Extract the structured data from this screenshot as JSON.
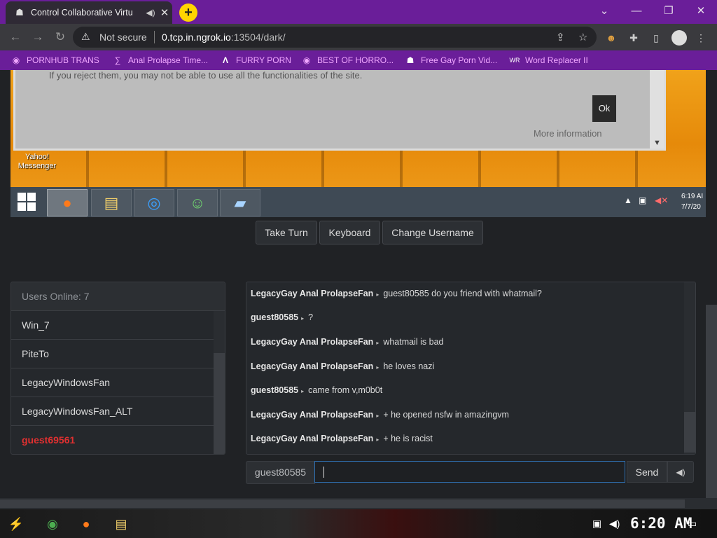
{
  "browser": {
    "tab_title": "Control Collaborative Virtu",
    "address_warning": "Not secure",
    "url_host": "0.tcp.in.ngrok.io",
    "url_rest": ":13504/dark/",
    "bookmarks": [
      {
        "label": "PORNHUB TRANS",
        "icon": "globe-icon"
      },
      {
        "label": "Anal Prolapse Time...",
        "icon": "bookmark-icon"
      },
      {
        "label": "FURRY PORN",
        "icon": "lambda-icon"
      },
      {
        "label": "BEST OF HORRO...",
        "icon": "globe-icon"
      },
      {
        "label": "Free Gay Porn Vid...",
        "icon": "site-icon"
      },
      {
        "label": "Word Replacer II",
        "icon": "extension-icon"
      }
    ]
  },
  "vm": {
    "dialog_text": "If you reject them, you may not be able to use all the functionalities of the site.",
    "ok_label": "Ok",
    "more_info": "More information",
    "desktop_icon": {
      "line1": "Yahoo!",
      "line2": "Messenger"
    },
    "clock_time": "6:19 AI",
    "clock_date": "7/7/20"
  },
  "controls": {
    "take_turn": "Take Turn",
    "keyboard": "Keyboard",
    "change_username": "Change Username"
  },
  "users": {
    "header": "Users Online: 7",
    "list": [
      "Win_7",
      "PiteTo",
      "LegacyWindowsFan",
      "LegacyWindowsFan_ALT",
      "guest69561"
    ]
  },
  "chat": {
    "messages": [
      {
        "user": "LegacyGay Anal ProlapseFan",
        "text": "guest80585 do you friend with whatmail?"
      },
      {
        "user": "guest80585",
        "text": "?"
      },
      {
        "user": "LegacyGay Anal ProlapseFan",
        "text": "whatmail is bad"
      },
      {
        "user": "LegacyGay Anal ProlapseFan",
        "text": "he loves nazi"
      },
      {
        "user": "guest80585",
        "text": "came from v,m0b0t"
      },
      {
        "user": "LegacyGay Anal ProlapseFan",
        "text": "+ he opened nsfw in amazingvm"
      },
      {
        "user": "LegacyGay Anal ProlapseFan",
        "text": "+ he is racist"
      }
    ],
    "username": "guest80585",
    "input_value": "",
    "send_label": "Send"
  },
  "host": {
    "clock": "6:20 AM"
  },
  "colors": {
    "tabbar": "#6a1e99",
    "bookmark_text": "#f0a6ff",
    "self_user": "#e03030"
  }
}
